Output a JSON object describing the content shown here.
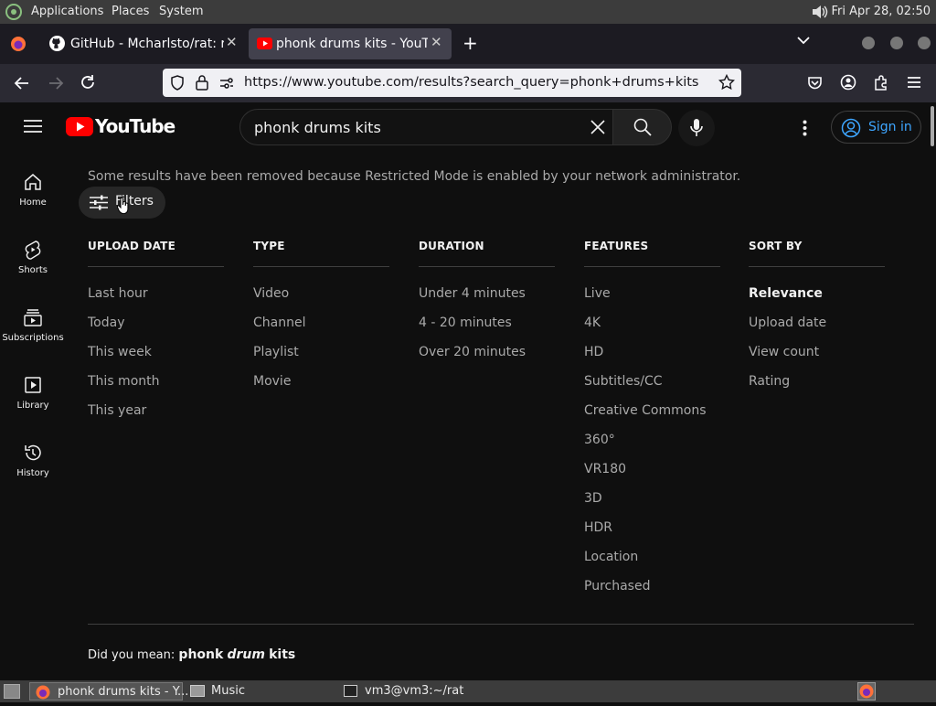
{
  "os_panel": {
    "menus": [
      "Applications",
      "Places",
      "System"
    ],
    "clock": "Fri Apr 28, 02:50"
  },
  "browser": {
    "tabs": [
      {
        "title": "GitHub - Mcharlsto/rat: rat",
        "icon": "github-icon"
      },
      {
        "title": "phonk drums kits - YouTube",
        "icon": "youtube-icon",
        "active": true
      }
    ],
    "url": "https://www.youtube.com/results?search_query=phonk+drums+kits"
  },
  "youtube": {
    "logo_text": "YouTube",
    "search_query": "phonk drums kits",
    "sign_in_label": "Sign in",
    "sidebar": [
      {
        "label": "Home",
        "icon": "home-icon"
      },
      {
        "label": "Shorts",
        "icon": "shorts-icon"
      },
      {
        "label": "Subscriptions",
        "icon": "subscriptions-icon"
      },
      {
        "label": "Library",
        "icon": "library-icon"
      },
      {
        "label": "History",
        "icon": "history-icon"
      }
    ],
    "restricted_notice": "Some results have been removed because Restricted Mode is enabled by your network administrator.",
    "filters_label": "Filters",
    "filter_groups": [
      {
        "heading": "UPLOAD DATE",
        "items": [
          "Last hour",
          "Today",
          "This week",
          "This month",
          "This year"
        ]
      },
      {
        "heading": "TYPE",
        "items": [
          "Video",
          "Channel",
          "Playlist",
          "Movie"
        ]
      },
      {
        "heading": "DURATION",
        "items": [
          "Under 4 minutes",
          "4 - 20 minutes",
          "Over 20 minutes"
        ]
      },
      {
        "heading": "FEATURES",
        "items": [
          "Live",
          "4K",
          "HD",
          "Subtitles/CC",
          "Creative Commons",
          "360°",
          "VR180",
          "3D",
          "HDR",
          "Location",
          "Purchased"
        ]
      },
      {
        "heading": "SORT BY",
        "items": [
          "Relevance",
          "Upload date",
          "View count",
          "Rating"
        ],
        "selected": "Relevance"
      }
    ],
    "did_you_mean_label": "Did you mean:",
    "did_you_mean_prefix": "phonk",
    "did_you_mean_emph": "drum",
    "did_you_mean_suffix": "kits"
  },
  "taskbar": {
    "tasks": [
      "phonk drums kits - Y...",
      "Music",
      "vm3@vm3:~/rat"
    ]
  },
  "colors": {
    "accent": "#3ea6ff",
    "youtube_red": "#ff0000",
    "bg": "#0f0f0f"
  }
}
